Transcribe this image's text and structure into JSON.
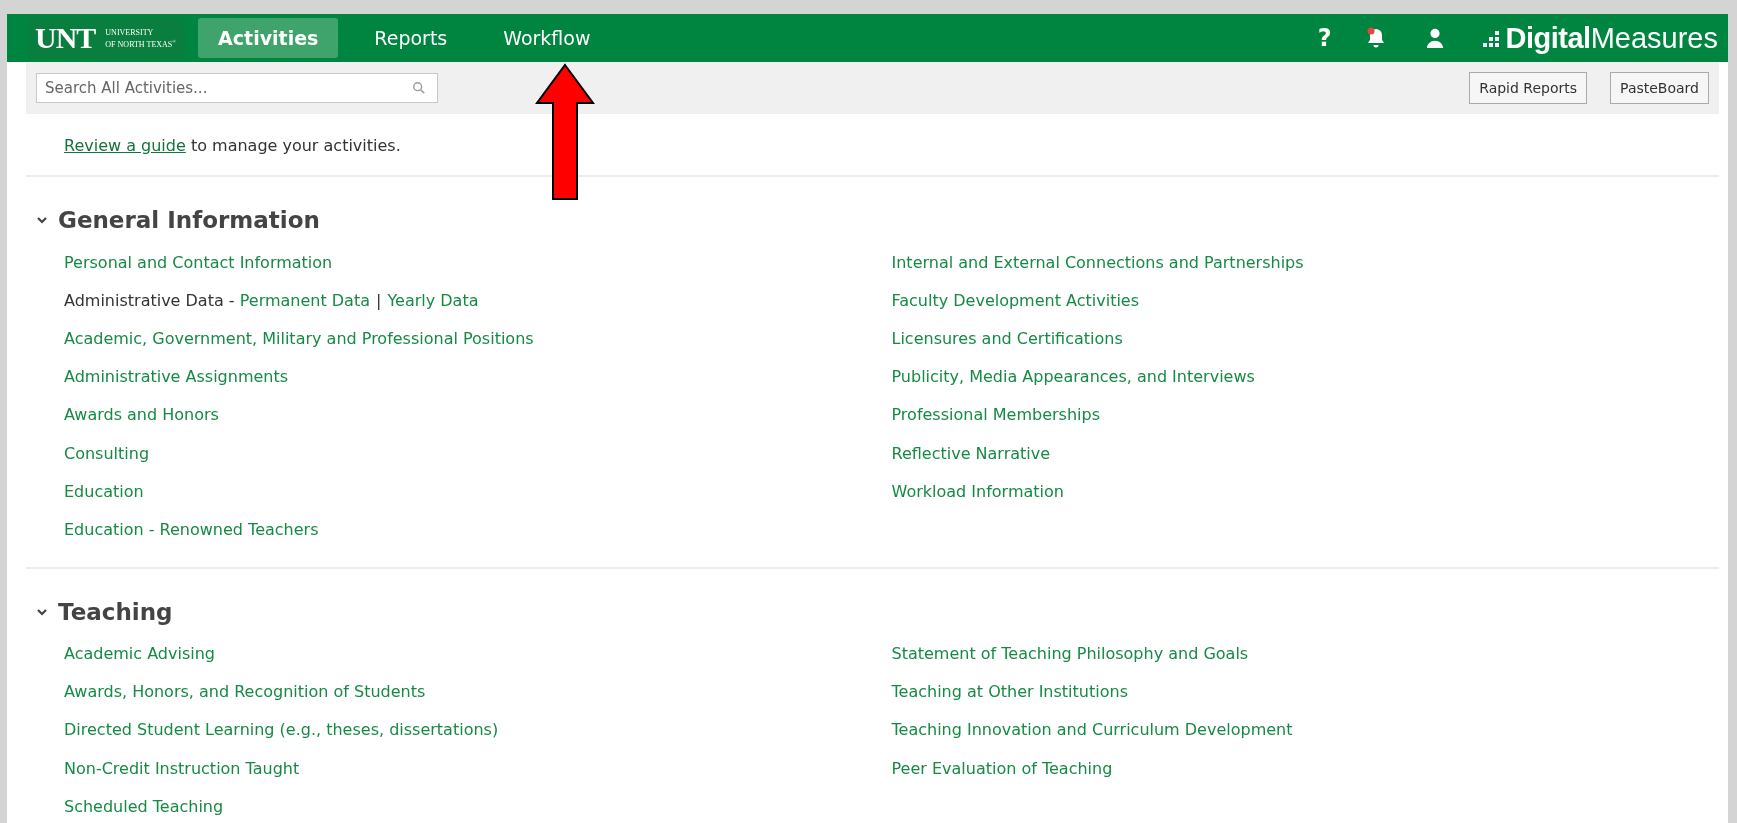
{
  "header": {
    "logo": {
      "wordmark": "UNT",
      "line1": "UNIVERSITY",
      "line2": "OF NORTH TEXAS",
      "mark": "®"
    },
    "tabs": [
      {
        "label": "Activities",
        "selected": true
      },
      {
        "label": "Reports",
        "selected": false
      },
      {
        "label": "Workflow",
        "selected": false
      }
    ],
    "icons": [
      "?"
    ],
    "notification_dot": true,
    "brand": {
      "bold": "Digital",
      "light": "Measures"
    }
  },
  "toolbar": {
    "search": {
      "placeholder": "Search All Activities..."
    },
    "buttons": [
      "Rapid Reports",
      "PasteBoard"
    ]
  },
  "guide": {
    "link": "Review a guide",
    "text": " to manage your activities."
  },
  "sections": [
    {
      "title": "General Information",
      "expanded": true,
      "columns": [
        [
          {
            "kind": "link",
            "label": "Personal and Contact Information"
          },
          {
            "kind": "composite",
            "label": "Administrative Data - ",
            "links": [
              "Permanent Data",
              "Yearly Data"
            ],
            "separator": "|"
          },
          {
            "kind": "link",
            "label": "Academic, Government, Military and Professional Positions"
          },
          {
            "kind": "link",
            "label": "Administrative Assignments"
          },
          {
            "kind": "link",
            "label": "Awards and Honors"
          },
          {
            "kind": "link",
            "label": "Consulting"
          },
          {
            "kind": "link",
            "label": "Education"
          },
          {
            "kind": "link",
            "label": "Education - Renowned Teachers"
          }
        ],
        [
          {
            "kind": "link",
            "label": "Internal and External Connections and Partnerships"
          },
          {
            "kind": "link",
            "label": "Faculty Development Activities"
          },
          {
            "kind": "link",
            "label": "Licensures and Certifications"
          },
          {
            "kind": "link",
            "label": "Publicity, Media Appearances, and Interviews"
          },
          {
            "kind": "link",
            "label": "Professional Memberships"
          },
          {
            "kind": "link",
            "label": "Reflective Narrative"
          },
          {
            "kind": "link",
            "label": "Workload Information"
          }
        ]
      ]
    },
    {
      "title": "Teaching",
      "expanded": true,
      "columns": [
        [
          {
            "kind": "link",
            "label": "Academic Advising"
          },
          {
            "kind": "link",
            "label": "Awards, Honors, and Recognition of Students"
          },
          {
            "kind": "link",
            "label": "Directed Student Learning (e.g., theses, dissertations)"
          },
          {
            "kind": "link",
            "label": "Non-Credit Instruction Taught"
          },
          {
            "kind": "link",
            "label": "Scheduled Teaching"
          }
        ],
        [
          {
            "kind": "link",
            "label": "Statement of Teaching Philosophy and Goals"
          },
          {
            "kind": "link",
            "label": "Teaching at Other Institutions"
          },
          {
            "kind": "link",
            "label": "Teaching Innovation and Curriculum Development"
          },
          {
            "kind": "link",
            "label": "Peer Evaluation of Teaching"
          }
        ]
      ]
    }
  ],
  "annotation": {
    "kind": "arrow"
  }
}
